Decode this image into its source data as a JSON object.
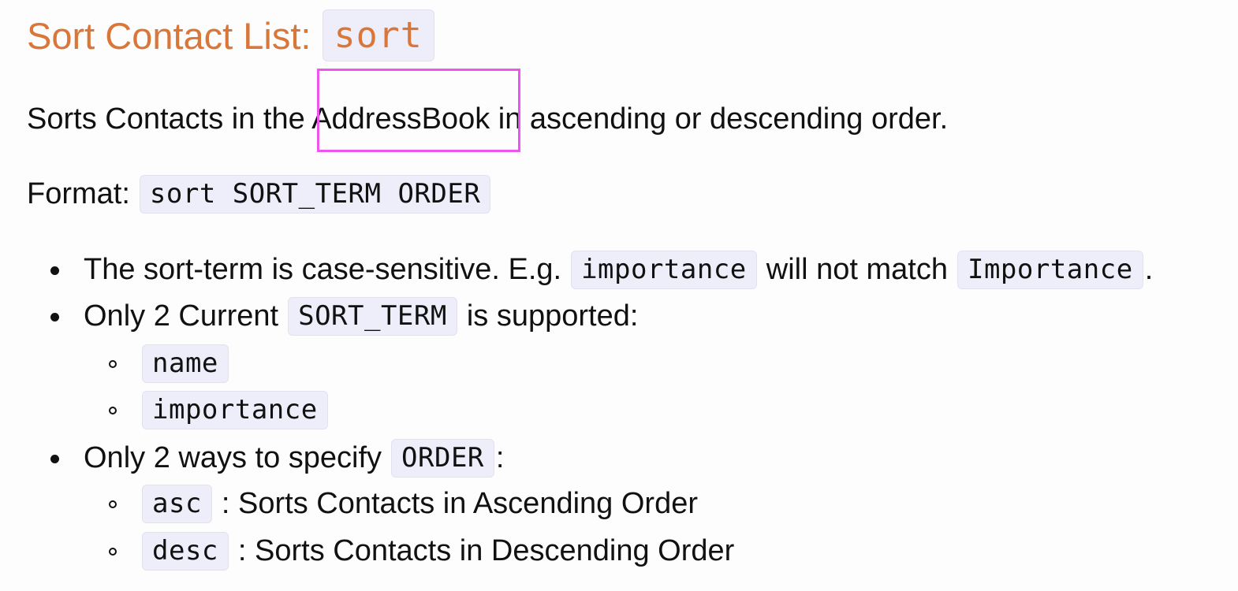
{
  "heading": {
    "text": "Sort Contact List:",
    "command": "sort"
  },
  "description": {
    "before": "Sorts Contacts in the ",
    "highlighted": "AddressBook",
    "after": " in ascending or descending order."
  },
  "format": {
    "label": "Format:",
    "code": "sort SORT_TERM ORDER"
  },
  "bullets": {
    "case_sensitive": {
      "text1": "The sort-term is case-sensitive. E.g.",
      "code1": "importance",
      "text2": "will not match",
      "code2": "Importance",
      "text3": "."
    },
    "sort_term": {
      "text1": "Only 2 Current",
      "code1": "SORT_TERM",
      "text2": "is supported:",
      "options": [
        "name",
        "importance"
      ]
    },
    "order": {
      "text1": "Only 2 ways to specify",
      "code1": "ORDER",
      "text2": ":",
      "options": [
        {
          "code": "asc",
          "text": ": Sorts Contacts in Ascending Order"
        },
        {
          "code": "desc",
          "text": ": Sorts Contacts in Descending Order"
        }
      ]
    }
  },
  "colors": {
    "heading": "#d9773a",
    "code_background": "#eeeefa",
    "highlight_box": "#ee55ee"
  }
}
